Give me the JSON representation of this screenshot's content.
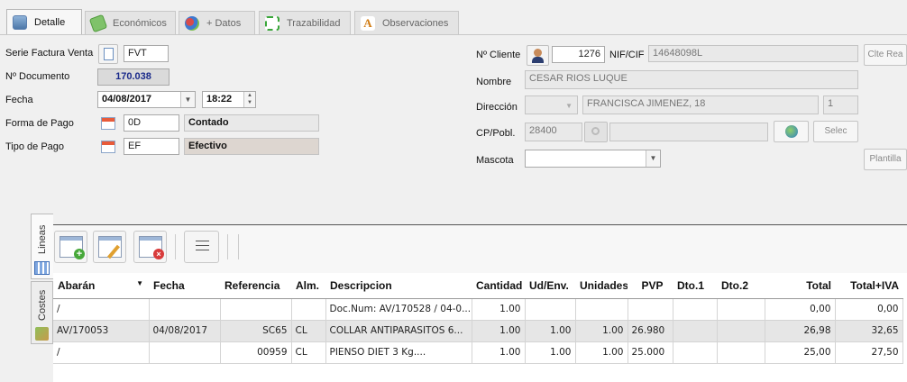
{
  "tabs": [
    {
      "label": "Detalle",
      "icon": "detail-icon"
    },
    {
      "label": "Económicos",
      "icon": "money-icon"
    },
    {
      "label": "+ Datos",
      "icon": "more-data-icon"
    },
    {
      "label": "Trazabilidad",
      "icon": "traceability-icon"
    },
    {
      "label": "Observaciones",
      "icon": "observations-icon"
    }
  ],
  "form": {
    "serie_label": "Serie Factura Venta",
    "serie_value": "FVT",
    "documento_label": "Nº Documento",
    "documento_value": "170.038",
    "fecha_label": "Fecha",
    "fecha_value": "04/08/2017",
    "hora_value": "18:22",
    "forma_pago_label": "Forma de Pago",
    "forma_pago_code": "0D",
    "forma_pago_desc": "Contado",
    "tipo_pago_label": "Tipo de Pago",
    "tipo_pago_code": "EF",
    "tipo_pago_desc": "Efectivo",
    "cliente_label": "Nº Cliente",
    "cliente_value": "1276",
    "nif_label": "NIF/CIF",
    "nif_value": "14648098L",
    "clte_button": "Clte Rea",
    "nombre_label": "Nombre",
    "nombre_value": "CESAR RIOS LUQUE",
    "direccion_label": "Dirección",
    "direccion_value": "FRANCISCA JIMENEZ, 18",
    "direccion_num": "1",
    "cp_label": "CP/Pobl.",
    "cp_value": "28400",
    "pobl_value": "",
    "selec_button": "Selec",
    "mascota_label": "Mascota",
    "mascota_value": "",
    "plantilla_button": "Plantilla"
  },
  "side_tabs": [
    {
      "label": "Lineas"
    },
    {
      "label": "Costes"
    }
  ],
  "grid": {
    "columns": [
      "Abarán",
      "Fecha",
      "Referencia",
      "Alm.",
      "Descripcion",
      "Cantidad",
      "Ud/Env.",
      "Unidades",
      "PVP",
      "Dto.1",
      "Dto.2",
      "Total",
      "Total+IVA"
    ],
    "rows": [
      [
        "/",
        "",
        "",
        "",
        "Doc.Num: AV/170528 / 04-0...",
        "1.00",
        "",
        "",
        "",
        "",
        "",
        "0,00",
        "0,00"
      ],
      [
        "AV/170053",
        "04/08/2017",
        "SC65",
        "CL",
        "COLLAR ANTIPARASITOS  6...",
        "1.00",
        "1.00",
        "1.00",
        "26.980",
        "",
        "",
        "26,98",
        "32,65"
      ],
      [
        "/",
        "",
        "00959",
        "CL",
        "PIENSO DIET 3 Kg....",
        "1.00",
        "1.00",
        "1.00",
        "25.000",
        "",
        "",
        "25,00",
        "27,50"
      ]
    ]
  },
  "colors": {
    "accent_blue": "#1a2a8a",
    "selected_row": "#e6e6e6"
  }
}
